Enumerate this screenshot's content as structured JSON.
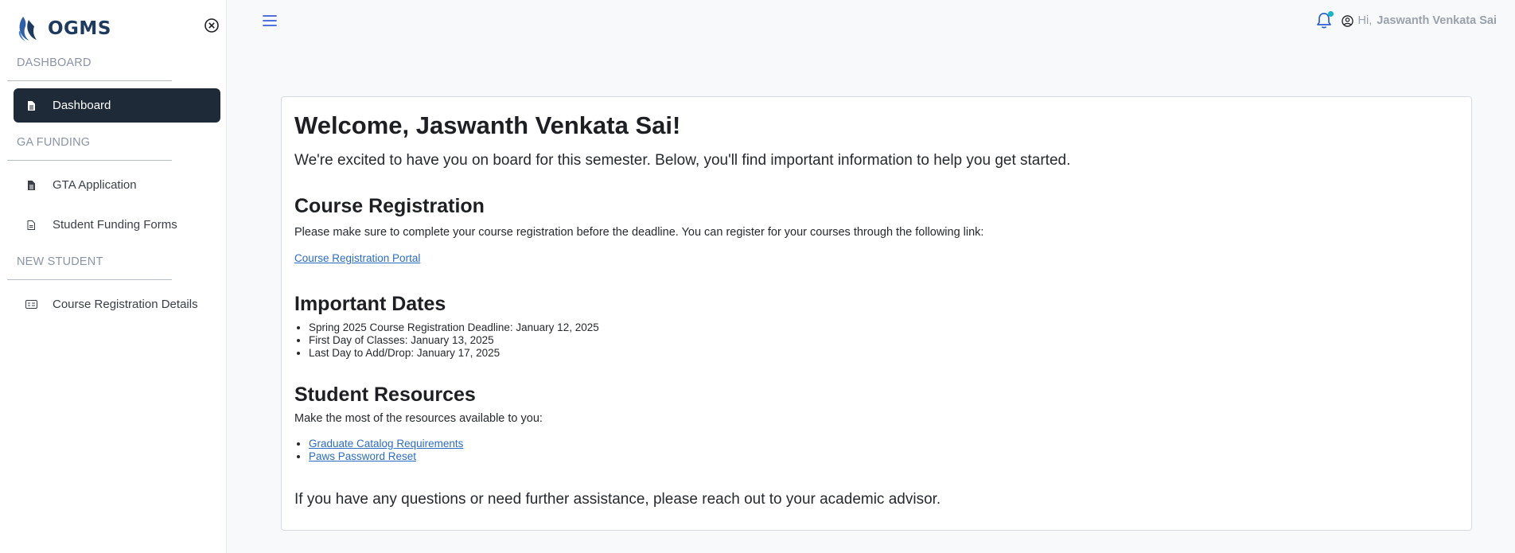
{
  "app": {
    "logo_text": "OGMS"
  },
  "sidebar": {
    "sections": [
      {
        "label": "DASHBOARD"
      },
      {
        "label": "GA FUNDING"
      },
      {
        "label": "NEW STUDENT"
      }
    ],
    "items": [
      {
        "label": "Dashboard",
        "icon": "document-icon",
        "active": true
      },
      {
        "label": "GTA Application",
        "icon": "document-icon"
      },
      {
        "label": "Student Funding Forms",
        "icon": "document-outline-icon"
      },
      {
        "label": "Course Registration Details",
        "icon": "id-card-icon"
      }
    ]
  },
  "topbar": {
    "greeting": "Hi,",
    "user_name": "Jaswanth Venkata Sai"
  },
  "main": {
    "title": "Welcome, Jaswanth Venkata Sai!",
    "intro": "We're excited to have you on board for this semester. Below, you'll find important information to help you get started.",
    "course_registration": {
      "heading": "Course Registration",
      "text": "Please make sure to complete your course registration before the deadline. You can register for your courses through the following link:",
      "link": "Course Registration Portal"
    },
    "important_dates": {
      "heading": "Important Dates",
      "items": [
        "Spring 2025 Course Registration Deadline: January 12, 2025",
        "First Day of Classes: January 13, 2025",
        "Last Day to Add/Drop: January 17, 2025"
      ]
    },
    "student_resources": {
      "heading": "Student Resources",
      "text": "Make the most of the resources available to you:",
      "links": [
        "Graduate Catalog Requirements",
        "Paws Password Reset"
      ]
    },
    "closing": "If you have any questions or need further assistance, please reach out to your academic advisor."
  },
  "colors": {
    "sidebar_active_bg": "#1f2a38",
    "accent_blue": "#2b6cc4",
    "notification_dot": "#14b8c4",
    "brand_navy": "#1e3a5f"
  }
}
